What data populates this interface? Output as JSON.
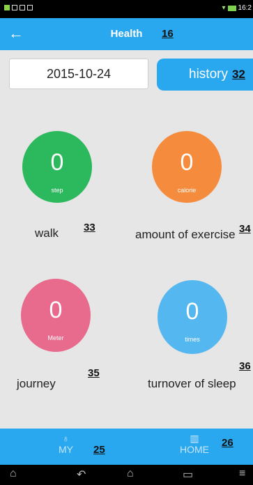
{
  "status_bar": {
    "time": "16:2"
  },
  "header": {
    "title": "Health",
    "annotation": "16"
  },
  "tabs": {
    "date": "2015-10-24",
    "history_label": "history",
    "history_annotation": "32"
  },
  "cards": [
    {
      "value": "0",
      "unit": "step",
      "label": "walk",
      "annotation": "33",
      "color": "#2cb85c"
    },
    {
      "value": "0",
      "unit": "calorie",
      "label": "amount of exercise",
      "annotation": "34",
      "color": "#f58b3c"
    },
    {
      "value": "0",
      "unit": "Meter",
      "label": "journey",
      "annotation": "35",
      "color": "#e86a8d"
    },
    {
      "value": "0",
      "unit": "times",
      "label": "turnover of sleep",
      "annotation": "36",
      "color": "#55b7ef"
    }
  ],
  "bottom_nav": {
    "my_label": "MY",
    "my_annotation": "25",
    "home_label": "HOME",
    "home_annotation": "26"
  },
  "colors": {
    "accent": "#2aa8ef",
    "background": "#e6e6e6"
  }
}
